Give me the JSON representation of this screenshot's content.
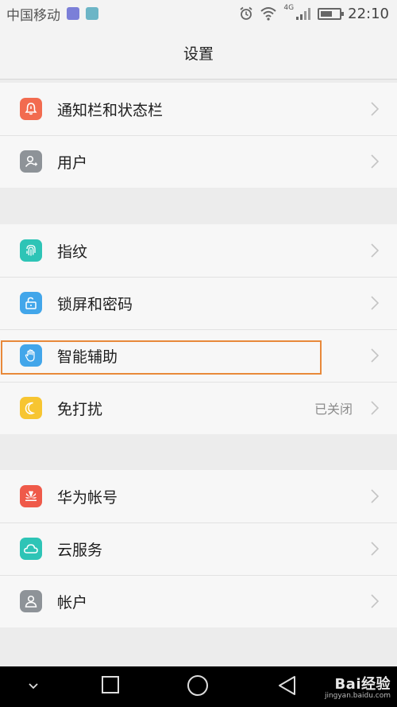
{
  "status_bar": {
    "carrier": "中国移动",
    "network": "4G",
    "time": "22:10",
    "icons": [
      "app-notification-icon",
      "gallery-notification-icon",
      "alarm-icon",
      "wifi-icon",
      "signal-icon",
      "battery-icon"
    ]
  },
  "header": {
    "title": "设置"
  },
  "groups": [
    {
      "items": [
        {
          "label": "通知栏和状态栏",
          "icon": "notification-bell-icon",
          "icon_color": "#f26b4f"
        },
        {
          "label": "用户",
          "icon": "user-icon",
          "icon_color": "#8e9398"
        }
      ]
    },
    {
      "items": [
        {
          "label": "指纹",
          "icon": "fingerprint-icon",
          "icon_color": "#2ec4b6"
        },
        {
          "label": "锁屏和密码",
          "icon": "padlock-icon",
          "icon_color": "#42a6ea"
        },
        {
          "label": "智能辅助",
          "icon": "hand-icon",
          "icon_color": "#42a6ea",
          "highlighted": true
        },
        {
          "label": "免打扰",
          "icon": "moon-icon",
          "icon_color": "#f7c531",
          "value": "已关闭"
        }
      ]
    },
    {
      "items": [
        {
          "label": "华为帐号",
          "icon": "huawei-logo-icon",
          "icon_color": "#ef5a4a"
        },
        {
          "label": "云服务",
          "icon": "cloud-icon",
          "icon_color": "#2ec4b6"
        },
        {
          "label": "帐户",
          "icon": "account-icon",
          "icon_color": "#8e9398"
        }
      ]
    }
  ],
  "nav_bar": {
    "buttons": [
      "collapse-chevron-icon",
      "recent-apps-icon",
      "home-icon",
      "back-icon"
    ]
  },
  "watermark": {
    "brand": "Bai经验",
    "url": "jingyan.baidu.com"
  },
  "highlight_color": "#e8893a"
}
